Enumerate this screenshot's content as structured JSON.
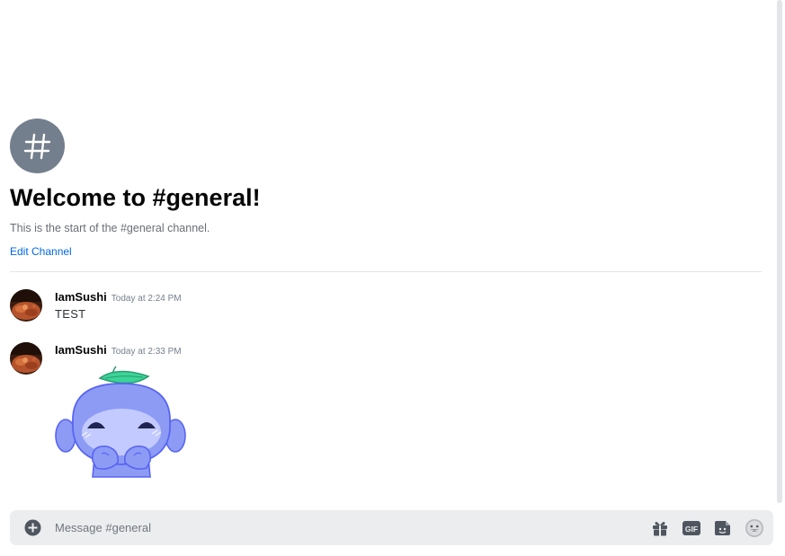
{
  "channel": {
    "name": "general",
    "hash_symbol": "#",
    "welcome_title": "Welcome to #general!",
    "welcome_subtitle": "This is the start of the #general channel.",
    "edit_link": "Edit Channel"
  },
  "messages": [
    {
      "username": "IamSushi",
      "timestamp": "Today at 2:24 PM",
      "text": "TEST"
    },
    {
      "username": "IamSushi",
      "timestamp": "Today at 2:33 PM",
      "sticker": "wumpus-sticker"
    }
  ],
  "composer": {
    "placeholder": "Message #general",
    "icons": [
      "add-icon",
      "gift-icon",
      "gif-icon",
      "sticker-icon",
      "emoji-icon"
    ]
  },
  "colors": {
    "accent_link": "#0068e0",
    "hash_circle": "#747f8d",
    "composer_bg": "#ebedef",
    "wumpus": "#8d9bf5",
    "leaf": "#3bd499"
  }
}
